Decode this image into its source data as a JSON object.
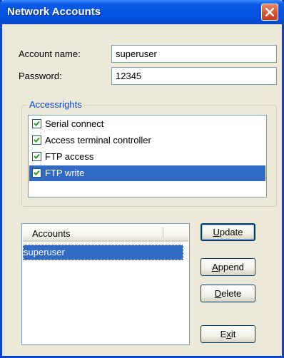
{
  "window": {
    "title": "Network Accounts"
  },
  "form": {
    "account_name_label": "Account name:",
    "account_name_value": "superuser",
    "password_label": "Password:",
    "password_value": "12345"
  },
  "accessrights": {
    "legend": "Accessrights",
    "items": [
      {
        "label": "Serial connect",
        "checked": true,
        "selected": false
      },
      {
        "label": "Access terminal controller",
        "checked": true,
        "selected": false
      },
      {
        "label": "FTP access",
        "checked": true,
        "selected": false
      },
      {
        "label": "FTP write",
        "checked": true,
        "selected": true
      }
    ]
  },
  "accounts": {
    "column_header": "Accounts",
    "rows": [
      "superuser"
    ]
  },
  "buttons": {
    "update_mnemonic": "U",
    "update_rest": "pdate",
    "append_mnemonic": "A",
    "append_rest": "ppend",
    "delete_mnemonic": "D",
    "delete_rest": "elete",
    "exit_first": "E",
    "exit_mnemonic": "x",
    "exit_rest": "it"
  },
  "colors": {
    "titlebar": "#0354e0",
    "selection": "#316ac5",
    "dialog_bg": "#ece9d8"
  }
}
